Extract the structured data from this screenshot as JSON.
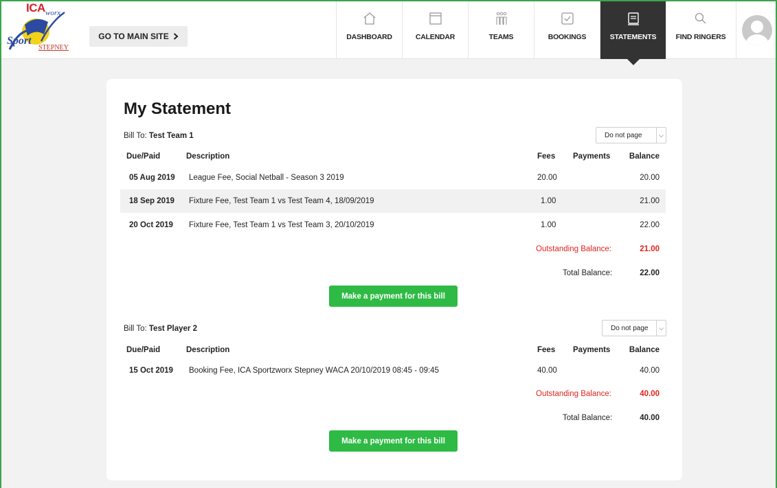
{
  "logo": {
    "ica": "ICA",
    "stepney": "STEPNEY"
  },
  "header": {
    "main_site_label": "GO TO MAIN SITE",
    "nav": [
      {
        "label": "DASHBOARD",
        "icon": "home-icon"
      },
      {
        "label": "CALENDAR",
        "icon": "calendar-icon"
      },
      {
        "label": "TEAMS",
        "icon": "teams-icon"
      },
      {
        "label": "BOOKINGS",
        "icon": "check-box-icon"
      },
      {
        "label": "STATEMENTS",
        "icon": "statement-icon",
        "active": true
      },
      {
        "label": "FIND RINGERS",
        "icon": "search-icon"
      }
    ]
  },
  "statement": {
    "title": "My Statement",
    "columns": {
      "date": "Due/Paid",
      "description": "Description",
      "fees": "Fees",
      "payments": "Payments",
      "balance": "Balance"
    },
    "bills": [
      {
        "bill_to_label": "Bill To:",
        "bill_to_name": "Test Team 1",
        "page_select": "Do not page",
        "rows": [
          {
            "date": "05 Aug 2019",
            "description": "League Fee, Social Netball - Season 3 2019",
            "fees": "20.00",
            "payments": "",
            "balance": "20.00"
          },
          {
            "date": "18 Sep 2019",
            "description": "Fixture Fee, Test Team 1 vs Test Team 4, 18/09/2019",
            "fees": "1.00",
            "payments": "",
            "balance": "21.00"
          },
          {
            "date": "20 Oct 2019",
            "description": "Fixture Fee, Test Team 1 vs Test Team 3, 20/10/2019",
            "fees": "1.00",
            "payments": "",
            "balance": "22.00"
          }
        ],
        "outstanding_label": "Outstanding Balance:",
        "outstanding_value": "21.00",
        "total_label": "Total Balance:",
        "total_value": "22.00",
        "pay_button": "Make a payment for this bill"
      },
      {
        "bill_to_label": "Bill To:",
        "bill_to_name": "Test Player 2",
        "page_select": "Do not page",
        "rows": [
          {
            "date": "15 Oct 2019",
            "description": "Booking Fee, ICA Sportzworx Stepney WACA 20/10/2019 08:45 - 09:45",
            "fees": "40.00",
            "payments": "",
            "balance": "40.00"
          }
        ],
        "outstanding_label": "Outstanding Balance:",
        "outstanding_value": "40.00",
        "total_label": "Total Balance:",
        "total_value": "40.00",
        "pay_button": "Make a payment for this bill"
      }
    ]
  },
  "colors": {
    "active_nav": "#333333",
    "pay_button": "#2fba45",
    "outstanding": "#e0241d",
    "frame": "#3aa64a"
  }
}
